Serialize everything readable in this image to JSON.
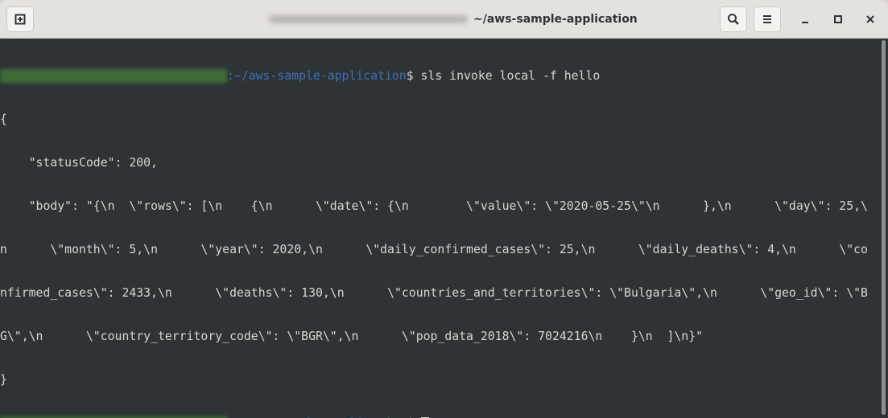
{
  "window": {
    "title": "~/aws-sample-application",
    "buttons": {
      "new_tab": "new-tab-icon",
      "search": "search-icon",
      "menu": "hamburger-menu-icon",
      "minimize": "minimize-icon",
      "maximize": "maximize-icon",
      "close": "close-icon"
    }
  },
  "terminal": {
    "prompt_path": ":~/aws-sample-application",
    "prompt_symbol": "$ ",
    "command": "sls invoke local -f hello",
    "output": [
      "{",
      "    \"statusCode\": 200,",
      "    \"body\": \"{\\n  \\\"rows\\\": [\\n    {\\n      \\\"date\\\": {\\n        \\\"value\\\": \\\"2020-05-25\\\"\\n      },\\n      \\\"day\\\": 25,\\",
      "n      \\\"month\\\": 5,\\n      \\\"year\\\": 2020,\\n      \\\"daily_confirmed_cases\\\": 25,\\n      \\\"daily_deaths\\\": 4,\\n      \\\"co",
      "nfirmed_cases\\\": 2433,\\n      \\\"deaths\\\": 130,\\n      \\\"countries_and_territories\\\": \\\"Bulgaria\\\",\\n      \\\"geo_id\\\": \\\"B",
      "G\\\",\\n      \\\"country_territory_code\\\": \\\"BGR\\\",\\n      \\\"pop_data_2018\\\": 7024216\\n    }\\n  ]\\n}\"",
      "}"
    ]
  },
  "colors": {
    "background": "#2e3436",
    "text": "#d3d7cf",
    "path": "#3b6fb6",
    "titlebar": "#e4e2df"
  }
}
